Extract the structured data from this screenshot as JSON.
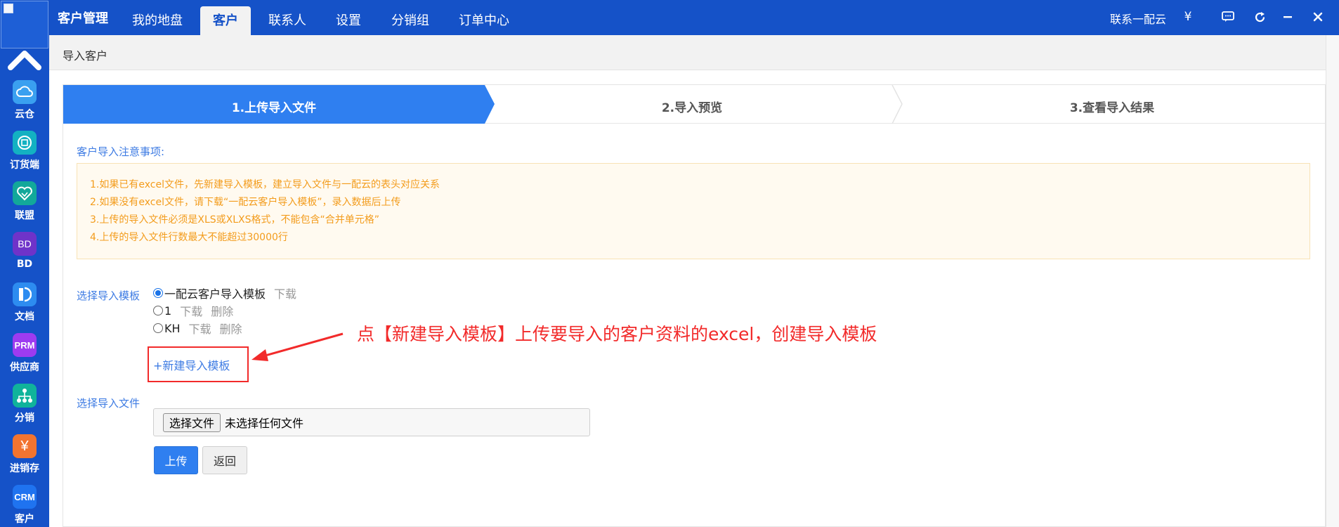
{
  "window": {
    "brand": "客户管理",
    "nav_tabs": [
      {
        "label": "我的地盘"
      },
      {
        "label": "客户",
        "active": true
      },
      {
        "label": "联系人"
      },
      {
        "label": "设置"
      },
      {
        "label": "分销组"
      },
      {
        "label": "订单中心"
      }
    ],
    "contact": "联系一配云",
    "icons": [
      "yen-icon",
      "chat-icon",
      "refresh-icon",
      "minimize-icon",
      "close-icon"
    ]
  },
  "sidebar": {
    "items": [
      {
        "label": "云仓",
        "icon": "cloud-icon",
        "color": "#3aa0f0"
      },
      {
        "label": "订货端",
        "icon": "order-icon",
        "color": "#13b1c2"
      },
      {
        "label": "联盟",
        "icon": "handshake-icon",
        "color": "#12a89a"
      },
      {
        "label": "BD",
        "icon_text": "BD",
        "color": "#6f33c9"
      },
      {
        "label": "文档",
        "icon": "document-icon",
        "color": "#2d8cf0"
      },
      {
        "label": "供应商",
        "icon_text": "PRM",
        "color": "#9d3bf0"
      },
      {
        "label": "分销",
        "icon": "hierarchy-icon",
        "color": "#10b39b"
      },
      {
        "label": "进销存",
        "icon_text": "¥",
        "color": "#f27430"
      },
      {
        "label": "客户",
        "icon_text": "CRM",
        "color": "#1f73f0"
      }
    ]
  },
  "page": {
    "title": "导入客户",
    "steps": [
      {
        "label": "1.上传导入文件",
        "active": true
      },
      {
        "label": "2.导入预览"
      },
      {
        "label": "3.查看导入结果"
      }
    ],
    "notes_title": "客户导入注意事项:",
    "notes": [
      "1.如果已有excel文件，先新建导入模板，建立导入文件与一配云的表头对应关系",
      "2.如果没有excel文件，请下载“一配云客户导入模板”，录入数据后上传",
      "3.上传的导入文件必须是XLS或XLXS格式，不能包含“合并单元格”",
      "4.上传的导入文件行数最大不能超过30000行"
    ],
    "template_label": "选择导入模板",
    "templates": [
      {
        "name": "一配云客户导入模板",
        "checked": true,
        "links": [
          "下载"
        ]
      },
      {
        "name": "1",
        "checked": false,
        "links": [
          "下载",
          "删除"
        ]
      },
      {
        "name": "KH",
        "checked": false,
        "links": [
          "下载",
          "删除"
        ]
      }
    ],
    "new_template": "+新建导入模板",
    "callout": "点【新建导入模板】上传要导入的客户资料的excel，创建导入模板",
    "file_label": "选择导入文件",
    "file_button": "选择文件",
    "file_status": "未选择任何文件",
    "upload_button": "上传",
    "back_button": "返回"
  },
  "colors": {
    "primary": "#1552c8",
    "step_active": "#2f7ff0",
    "link": "#3d7be3",
    "note_text": "#f39c1c",
    "note_bg": "#fffaf0",
    "annotation": "#f22a2a"
  }
}
